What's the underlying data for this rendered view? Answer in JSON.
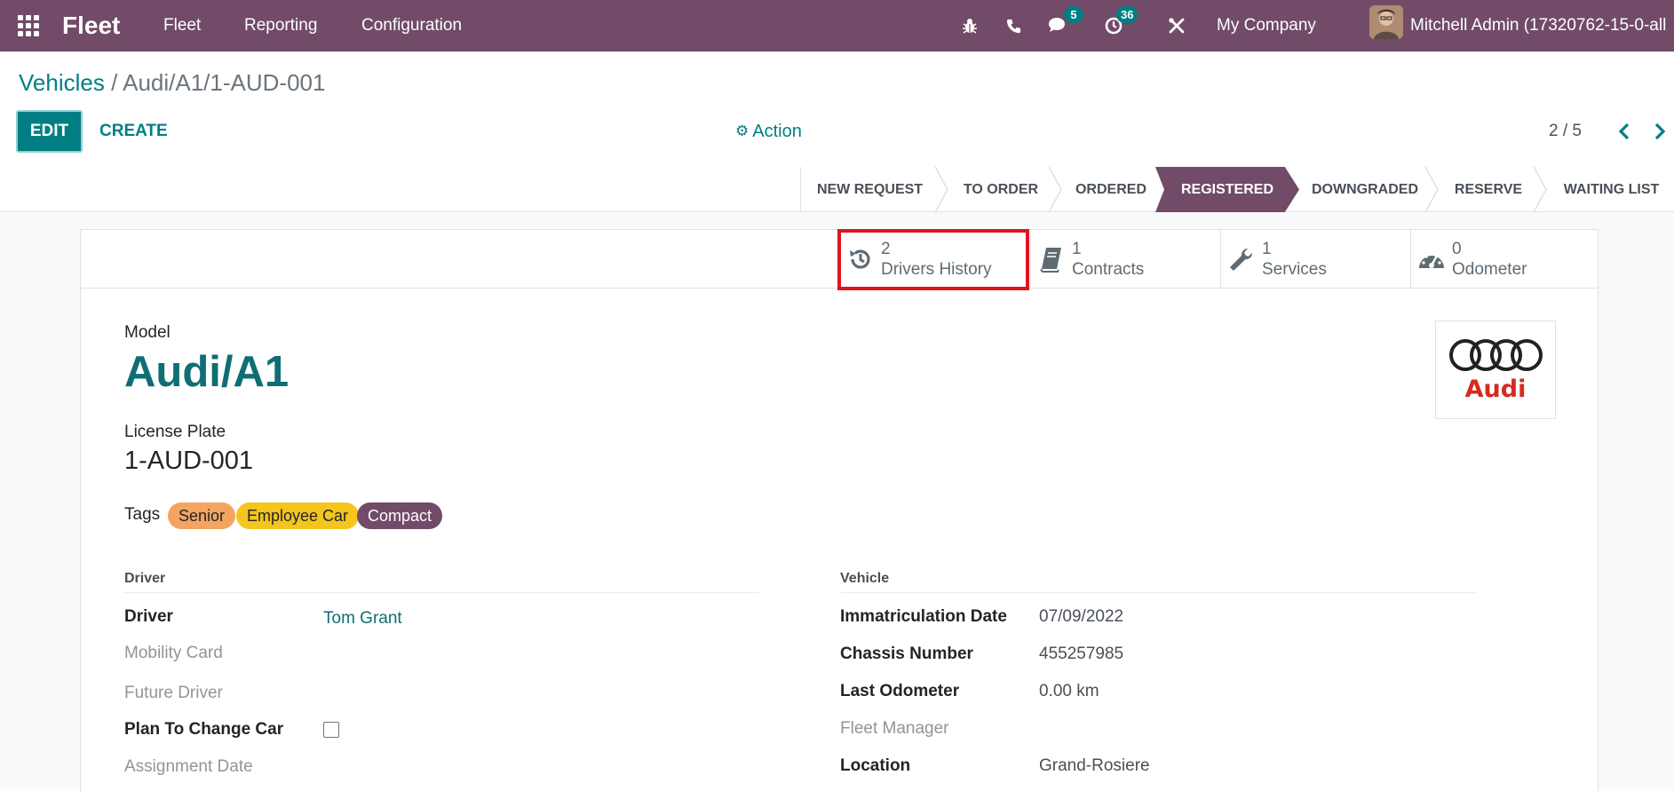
{
  "navbar": {
    "brand": "Fleet",
    "menu": [
      "Fleet",
      "Reporting",
      "Configuration"
    ],
    "messages_count": "5",
    "activities_count": "36",
    "company": "My Company",
    "user": "Mitchell Admin (17320762-15-0-all",
    "color": "#714b67"
  },
  "breadcrumb": {
    "parent": "Vehicles",
    "separator": "/",
    "current": "Audi/A1/1-AUD-001"
  },
  "toolbar": {
    "edit_label": "EDIT",
    "create_label": "CREATE",
    "action_label": "Action",
    "pager_value": "2 / 5"
  },
  "stages": {
    "items": [
      "NEW REQUEST",
      "TO ORDER",
      "ORDERED",
      "REGISTERED",
      "DOWNGRADED",
      "RESERVE",
      "WAITING LIST"
    ],
    "active": "REGISTERED"
  },
  "smart_buttons": [
    {
      "value": "2",
      "label": "Drivers History",
      "icon": "history-icon"
    },
    {
      "value": "1",
      "label": "Contracts",
      "icon": "book-icon"
    },
    {
      "value": "1",
      "label": "Services",
      "icon": "wrench-icon"
    },
    {
      "value": "0",
      "label": "Odometer",
      "icon": "tachometer-icon"
    }
  ],
  "form": {
    "model_label": "Model",
    "model_value": "Audi/A1",
    "plate_label": "License Plate",
    "plate_value": "1-AUD-001",
    "tags_label": "Tags",
    "tags": [
      {
        "label": "Senior",
        "color": "#f4a460"
      },
      {
        "label": "Employee Car",
        "color": "#f4c51d"
      },
      {
        "label": "Compact",
        "color": "#714b67"
      }
    ],
    "logo_text": "Audi"
  },
  "driver_group": {
    "title": "Driver",
    "fields": [
      {
        "label": "Driver",
        "value": "Tom Grant"
      },
      {
        "label": "Mobility Card",
        "value": ""
      },
      {
        "label": "Future Driver",
        "value": ""
      },
      {
        "label": "Plan To Change Car",
        "value": ""
      },
      {
        "label": "Assignment Date",
        "value": ""
      }
    ]
  },
  "vehicle_group": {
    "title": "Vehicle",
    "fields": [
      {
        "label": "Immatriculation Date",
        "value": "07/09/2022"
      },
      {
        "label": "Chassis Number",
        "value": "455257985"
      },
      {
        "label": "Last Odometer",
        "value": "0.00",
        "unit": "km"
      },
      {
        "label": "Fleet Manager",
        "value": ""
      },
      {
        "label": "Location",
        "value": "Grand-Rosiere"
      }
    ]
  }
}
